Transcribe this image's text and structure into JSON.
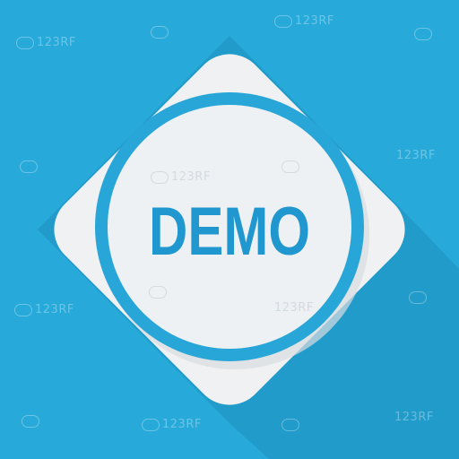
{
  "icon": {
    "label": "DEMO",
    "shape": "rounded-diamond",
    "ring": "circle"
  },
  "colors": {
    "background": "#27a9d9",
    "shadow": "#1e8fbd",
    "diamond": "#f3f5f6",
    "inner_circle": "#eef1f3",
    "ring": "#29a6d8",
    "label": "#2197cf"
  },
  "watermark": {
    "text": "123RF"
  }
}
